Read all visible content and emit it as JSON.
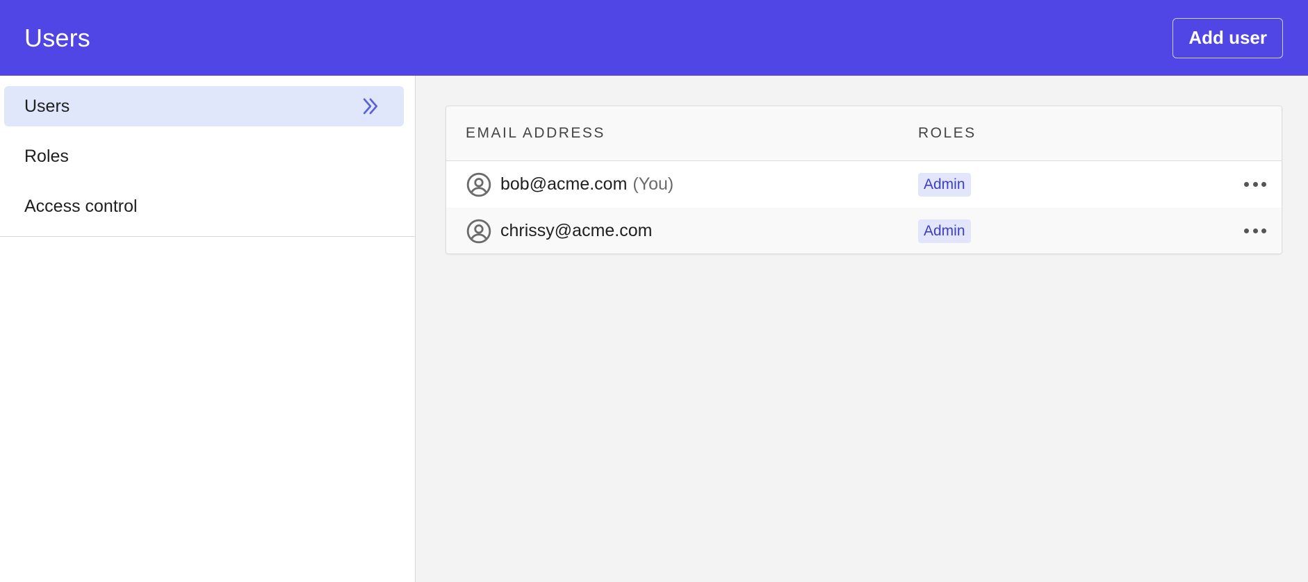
{
  "header": {
    "title": "Users",
    "add_user_label": "Add user"
  },
  "sidebar": {
    "items": [
      {
        "label": "Users",
        "active": true,
        "icon": "chevrons-right-icon"
      },
      {
        "label": "Roles",
        "active": false
      },
      {
        "label": "Access control",
        "active": false
      }
    ]
  },
  "table": {
    "columns": [
      "EMAIL ADDRESS",
      "ROLES"
    ],
    "rows": [
      {
        "email": "bob@acme.com",
        "suffix": "(You)",
        "role": "Admin",
        "icon": "user-circle-icon",
        "actions_icon": "more-horizontal-icon"
      },
      {
        "email": "chrissy@acme.com",
        "suffix": "",
        "role": "Admin",
        "icon": "user-circle-icon",
        "actions_icon": "more-horizontal-icon"
      }
    ]
  },
  "colors": {
    "header_bg": "#4f46e5",
    "active_nav_bg": "#e0e7fb",
    "badge_bg": "#e3e6fb",
    "badge_text": "#3b3fc4"
  }
}
